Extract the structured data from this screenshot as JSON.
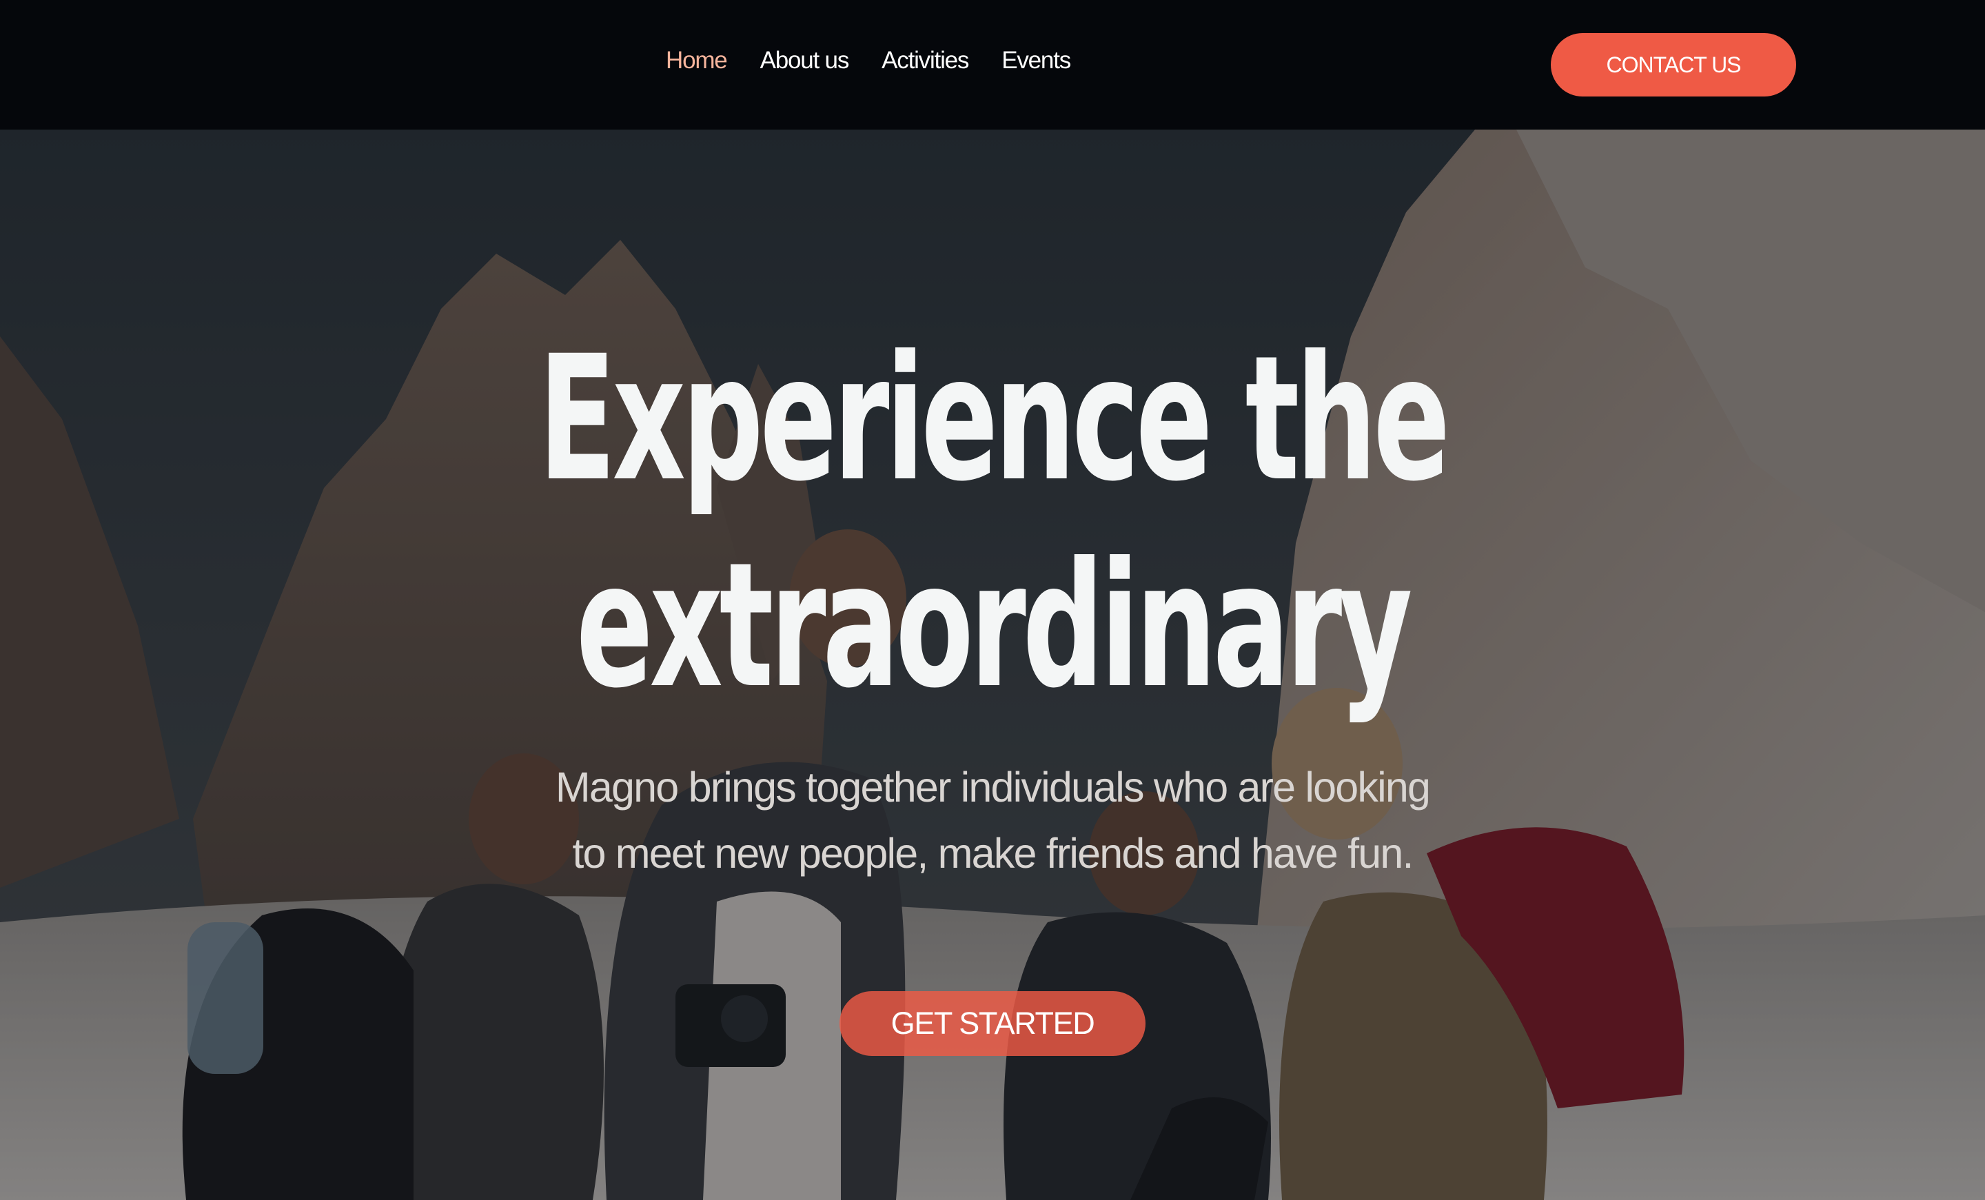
{
  "nav": {
    "links": [
      {
        "label": "Home",
        "active": true
      },
      {
        "label": "About us",
        "active": false
      },
      {
        "label": "Activities",
        "active": false
      },
      {
        "label": "Events",
        "active": false
      }
    ],
    "contact_label": "CONTACT US"
  },
  "hero": {
    "title_line1": "Experience the",
    "title_line2": "extraordinary",
    "subtitle": "Magno brings together individuals who are looking to meet new people, make friends and have fun.",
    "cta_label": "GET STARTED",
    "background_image": "group of four hikers laughing in front of rocky mountain peaks"
  },
  "colors": {
    "accent": "#ef5a45",
    "active_link": "#f6b49c",
    "nav_background": "#05070b",
    "title_text": "#f4f6f6"
  }
}
